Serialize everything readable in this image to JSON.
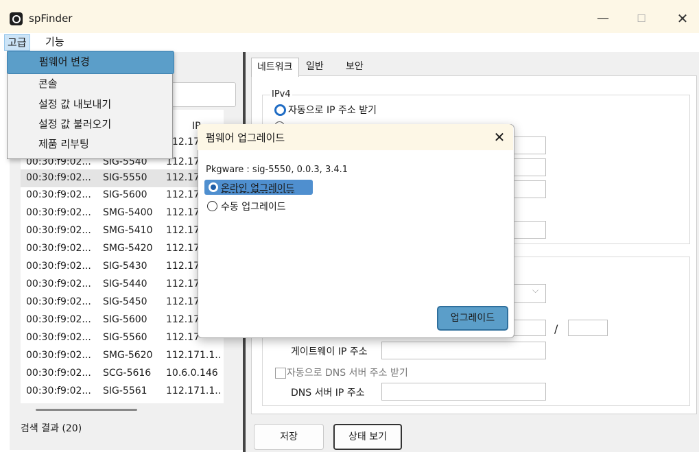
{
  "window": {
    "title": "spFinder",
    "minimize": "—",
    "maximize": "☐",
    "close": "✕"
  },
  "menubar": {
    "advanced": "고급",
    "functions": "기능"
  },
  "advanced_menu": {
    "items": [
      "펌웨어 변경",
      "콘솔",
      "설정 값 내보내기",
      "설정 값 불러오기",
      "제품 리부팅"
    ],
    "highlighted": "펌웨어 변경"
  },
  "device_list": {
    "header_ip": "IP",
    "rows": [
      {
        "mac": "00:30:f9:02...",
        "model": "SIG-5540",
        "ip": "112.17"
      },
      {
        "mac": "00:30:f9:02...",
        "model": "SIG-5550",
        "ip": "112.17"
      },
      {
        "mac": "00:30:f9:02...",
        "model": "SIG-5600",
        "ip": "112.17"
      },
      {
        "mac": "00:30:f9:02...",
        "model": "SMG-5400",
        "ip": "112.17"
      },
      {
        "mac": "00:30:f9:02...",
        "model": "SMG-5410",
        "ip": "112.17"
      },
      {
        "mac": "00:30:f9:02...",
        "model": "SMG-5420",
        "ip": "112.17"
      },
      {
        "mac": "00:30:f9:02...",
        "model": "SIG-5430",
        "ip": "112.17"
      },
      {
        "mac": "00:30:f9:02...",
        "model": "SIG-5440",
        "ip": "112.17"
      },
      {
        "mac": "00:30:f9:02...",
        "model": "SIG-5450",
        "ip": "112.17"
      },
      {
        "mac": "00:30:f9:02...",
        "model": "SIG-5600",
        "ip": "112.17"
      },
      {
        "mac": "00:30:f9:02...",
        "model": "SIG-5560",
        "ip": "112.17"
      },
      {
        "mac": "00:30:f9:02...",
        "model": "SMG-5620",
        "ip": "112.171.1.."
      },
      {
        "mac": "00:30:f9:02...",
        "model": "SCG-5616",
        "ip": "10.6.0.146"
      },
      {
        "mac": "00:30:f9:02...",
        "model": "SIG-5561",
        "ip": "112.171.1.."
      }
    ],
    "partial_row_ip": "112.17",
    "result_count": "검색 결과 (20)"
  },
  "tabs": [
    "네트워크",
    "일반",
    "보안"
  ],
  "network": {
    "ipv4_legend": "IPv4",
    "auto_ip": "자동으로 IP 주소 받기",
    "gateway_label": "게이트웨이 IP 주소",
    "dns_auto": "자동으로 DNS 서버 주소 받기",
    "dns_ip_label": "DNS 서버 IP 주소",
    "slash": "/"
  },
  "buttons": {
    "save": "저장",
    "status": "상태 보기"
  },
  "firmware_dialog": {
    "title": "펌웨어 업그레이드",
    "close": "✕",
    "package_info": "Pkgware : sig-5550, 0.0.3, 3.4.1",
    "online_option": "온라인 업그레이드",
    "manual_option": "수동 업그레이드",
    "selected": "온라인 업그레이드",
    "upgrade_button": "업그레이드"
  },
  "colors": {
    "accent": "#5b9ec9",
    "titlebar": "#fdf7e6",
    "radio_selected": "#1f6cc4"
  }
}
